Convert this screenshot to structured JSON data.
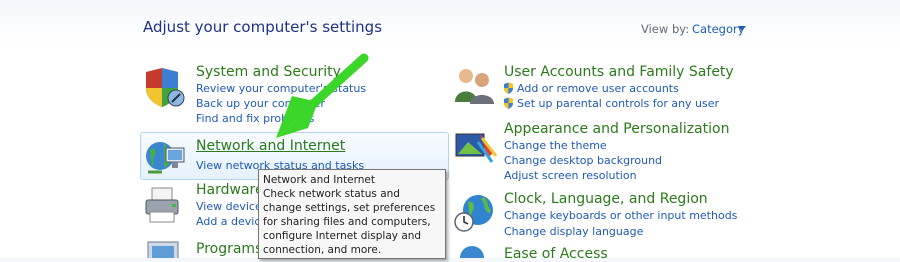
{
  "header": {
    "title": "Adjust your computer's settings",
    "view_by_label": "View by:",
    "view_by_value": "Category"
  },
  "left_column": [
    {
      "title": "System and Security",
      "icon": "security-shield-icon",
      "links": [
        "Review your computer's status",
        "Back up your computer",
        "Find and fix problems"
      ]
    },
    {
      "title": "Network and Internet",
      "icon": "network-globe-icon",
      "links": [
        "View network status and tasks"
      ]
    },
    {
      "title": "Hardware and Sound",
      "icon": "printer-icon",
      "links": [
        "View devices and printers",
        "Add a device"
      ]
    },
    {
      "title": "Programs",
      "icon": "programs-icon",
      "links": []
    }
  ],
  "right_column": [
    {
      "title": "User Accounts and Family Safety",
      "icon": "users-icon",
      "links": [
        "Add or remove user accounts",
        "Set up parental controls for any user"
      ]
    },
    {
      "title": "Appearance and Personalization",
      "icon": "appearance-icon",
      "links": [
        "Change the theme",
        "Change desktop background",
        "Adjust screen resolution"
      ]
    },
    {
      "title": "Clock, Language, and Region",
      "icon": "clock-globe-icon",
      "links": [
        "Change keyboards or other input methods",
        "Change display language"
      ]
    },
    {
      "title": "Ease of Access",
      "icon": "ease-of-access-icon",
      "links": []
    }
  ],
  "tooltip": {
    "title": "Network and Internet",
    "body": "Check network status and change settings, set preferences for sharing files and computers, configure Internet display and connection, and more."
  },
  "colors": {
    "title": "#1e3287",
    "category": "#2c7a1b",
    "link": "#1e5bb5",
    "arrow": "#3bd629"
  }
}
